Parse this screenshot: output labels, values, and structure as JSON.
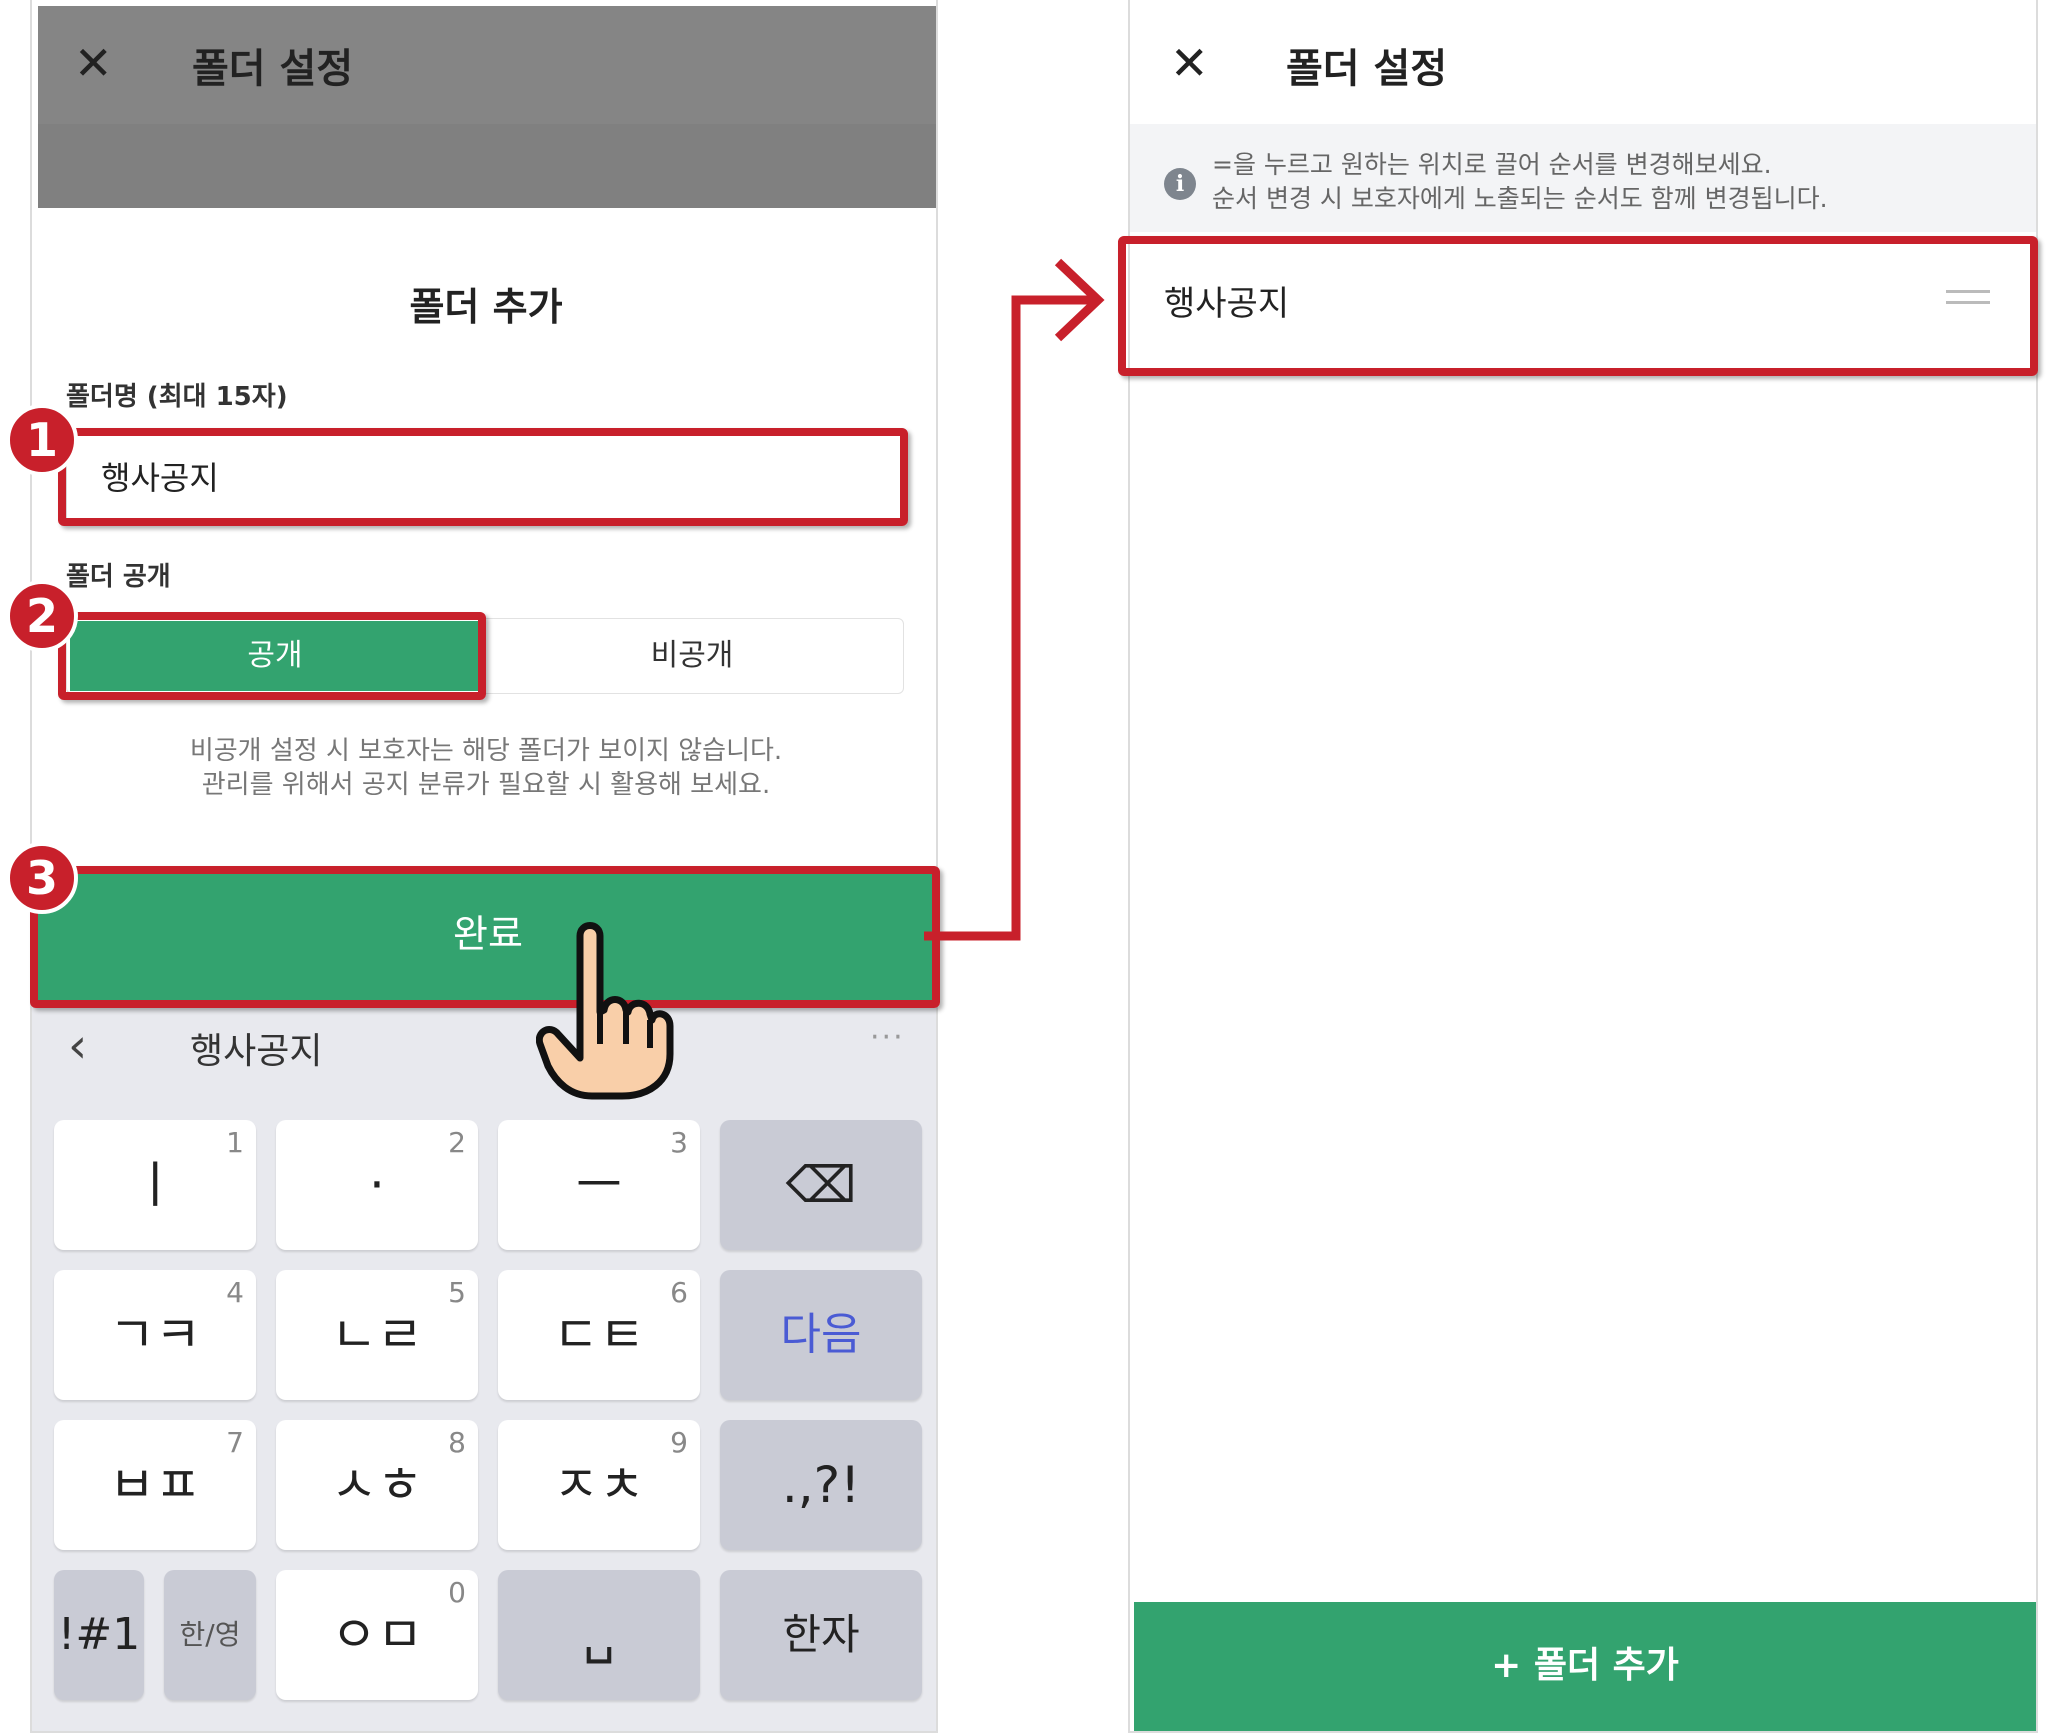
{
  "left": {
    "header_title": "폴더 설정",
    "sheet_title": "폴더 추가",
    "name_label": "폴더명 (최대 15자)",
    "name_value": "행사공지",
    "visibility_label": "폴더 공개",
    "public_label": "공개",
    "private_label": "비공개",
    "note_line1": "비공개 설정 시 보호자는 해당 폴더가 보이지 않습니다.",
    "note_line2": "관리를 위해서 공지 분류가 필요할 시 활용해 보세요.",
    "done_label": "완료"
  },
  "keyboard": {
    "input_preview": "행사공지",
    "more": "···",
    "keys": [
      {
        "main": "ㅣ",
        "num": "1"
      },
      {
        "main": "·",
        "num": "2"
      },
      {
        "main": "ㅡ",
        "num": "3"
      },
      {
        "main": "⌫",
        "num": ""
      },
      {
        "main": "ㄱㅋ",
        "num": "4"
      },
      {
        "main": "ㄴㄹ",
        "num": "5"
      },
      {
        "main": "ㄷㅌ",
        "num": "6"
      },
      {
        "main": "다음",
        "num": ""
      },
      {
        "main": "ㅂㅍ",
        "num": "7"
      },
      {
        "main": "ㅅㅎ",
        "num": "8"
      },
      {
        "main": "ㅈㅊ",
        "num": "9"
      },
      {
        "main": ".,?!",
        "num": ""
      },
      {
        "main": "!#1",
        "num": ""
      },
      {
        "main": "한/영",
        "num": ""
      },
      {
        "main": "ㅇㅁ",
        "num": "0"
      },
      {
        "main": "␣",
        "num": ""
      },
      {
        "main": "한자",
        "num": ""
      }
    ]
  },
  "right": {
    "header_title": "폴더 설정",
    "info_line1": "=을 누르고 원하는 위치로 끌어 순서를 변경해보세요.",
    "info_line2": "순서 변경 시 보호자에게 노출되는 순서도 함께 변경됩니다.",
    "folder_item": "행사공지",
    "add_folder_label": "+ 폴더 추가"
  },
  "annotations": {
    "step1": "1",
    "step2": "2",
    "step3": "3"
  },
  "colors": {
    "accent_green": "#33a36f",
    "highlight_red": "#c8202b"
  }
}
